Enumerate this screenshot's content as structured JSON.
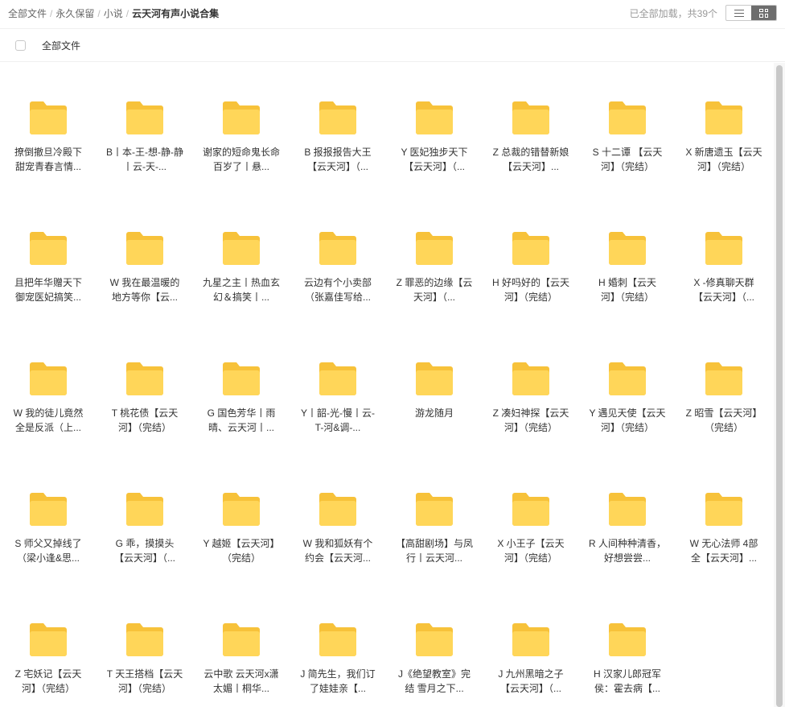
{
  "breadcrumb": {
    "items": [
      {
        "label": "全部文件"
      },
      {
        "label": "永久保留"
      },
      {
        "label": "小说"
      },
      {
        "label": "云天河有声小说合集"
      }
    ],
    "separator": "/"
  },
  "status_text": "已全部加载，共39个",
  "view_toggle": {
    "list_icon": "list-icon",
    "grid_icon": "grid-icon",
    "active": "grid"
  },
  "select_all": {
    "label": "全部文件",
    "checked": false
  },
  "colors": {
    "folder_back": "#F7C23A",
    "folder_front": "#FFD659",
    "text": "#333333",
    "muted": "#999999",
    "toggle_active": "#6D6D6D"
  },
  "folders": [
    {
      "name": "撩倒撤旦冷殿下 甜宠青春言情..."
    },
    {
      "name": "B丨本-王-想-静-静丨云-天-..."
    },
    {
      "name": "谢家的短命鬼长命百岁了丨悬..."
    },
    {
      "name": "B 报报报告大王【云天河】（..."
    },
    {
      "name": "Y 医妃独步天下【云天河】（..."
    },
    {
      "name": "Z 总裁的错替新娘【云天河】..."
    },
    {
      "name": "S 十二谭 【云天河】（完结）"
    },
    {
      "name": "X 新唐遗玉【云天河】（完结）"
    },
    {
      "name": "且把年华赠天下 御宠医妃搞笑..."
    },
    {
      "name": "W 我在最温暖的地方等你【云..."
    },
    {
      "name": "九星之主丨热血玄幻＆搞笑丨..."
    },
    {
      "name": "云边有个小卖部（张嘉佳写给..."
    },
    {
      "name": "Z 罪恶的边缘【云天河】（..."
    },
    {
      "name": "H 好吗好的【云天河】（完结）"
    },
    {
      "name": "H 婚刺【云天河】（完结）"
    },
    {
      "name": "X -修真聊天群【云天河】（..."
    },
    {
      "name": "W 我的徒儿竟然全是反派（上..."
    },
    {
      "name": "T 桃花债【云天河】（完结）"
    },
    {
      "name": "G 国色芳华丨雨晴、云天河丨..."
    },
    {
      "name": "Y丨韶-光-慢丨云-T-河&调-..."
    },
    {
      "name": "游龙随月"
    },
    {
      "name": "Z 凑妇神探【云天河】（完结）"
    },
    {
      "name": "Y 遇见天使【云天河】（完结）"
    },
    {
      "name": "Z 昭雪【云天河】（完结）"
    },
    {
      "name": "S 师父又掉线了（梁小逢&思..."
    },
    {
      "name": "G 乖，摸摸头【云天河】（..."
    },
    {
      "name": "Y 越姬【云天河】（完结）"
    },
    {
      "name": "W 我和狐妖有个约会【云天河..."
    },
    {
      "name": "【高甜剧场】与凤行丨云天河..."
    },
    {
      "name": "X 小王子【云天河】（完结）"
    },
    {
      "name": "R 人间种种清香，好想尝尝..."
    },
    {
      "name": "W 无心法师 4部全【云天河】..."
    },
    {
      "name": "Z 宅妖记【云天河】（完结）"
    },
    {
      "name": "T 天王搭档【云天河】（完结）"
    },
    {
      "name": "云中歌 云天河x潇太媚丨桐华..."
    },
    {
      "name": "J 简先生，我们订了娃娃亲【..."
    },
    {
      "name": "J《绝望教室》完结 雪月之下..."
    },
    {
      "name": "J 九州黑暗之子【云天河】（..."
    },
    {
      "name": "H 汉家儿郎冠军侯：霍去病【..."
    }
  ]
}
